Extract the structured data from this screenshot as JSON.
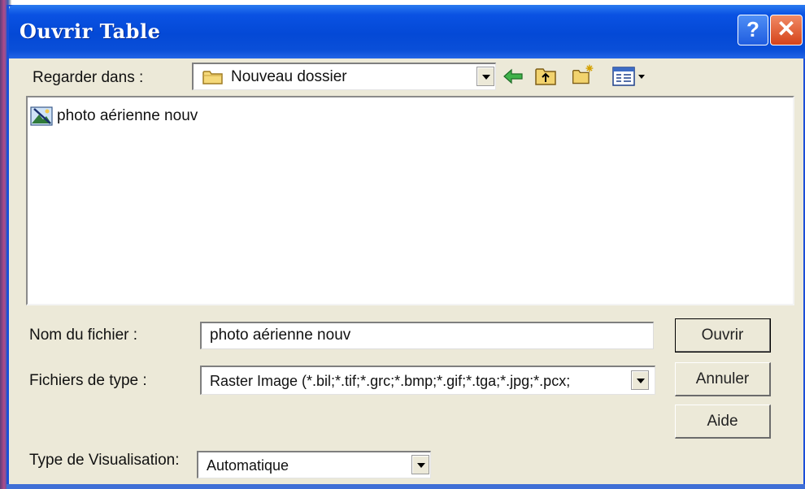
{
  "window": {
    "title": "Ouvrir Table",
    "help_glyph": "?",
    "close_glyph": "✕"
  },
  "lookin": {
    "label": "Regarder dans :",
    "value": "Nouveau dossier"
  },
  "toolbar": {
    "back_icon": "back-arrow-icon",
    "up_icon": "up-folder-icon",
    "new_folder_icon": "new-folder-icon",
    "view_menu_icon": "view-menu-icon"
  },
  "files": [
    {
      "name": "photo aérienne nouv",
      "icon": "raster-image-file-icon"
    }
  ],
  "filename": {
    "label": "Nom du fichier :",
    "value": "photo aérienne nouv"
  },
  "filetype": {
    "label": "Fichiers de type :",
    "value": "Raster Image (*.bil;*.tif;*.grc;*.bmp;*.gif;*.tga;*.jpg;*.pcx;"
  },
  "viewtype": {
    "label": "Type de Visualisation:",
    "value": "Automatique"
  },
  "buttons": {
    "open": "Ouvrir",
    "cancel": "Annuler",
    "help": "Aide"
  },
  "colors": {
    "titlebar": "#0449d6",
    "dialog_bg": "#ece9d8",
    "close_red": "#d5431b"
  }
}
